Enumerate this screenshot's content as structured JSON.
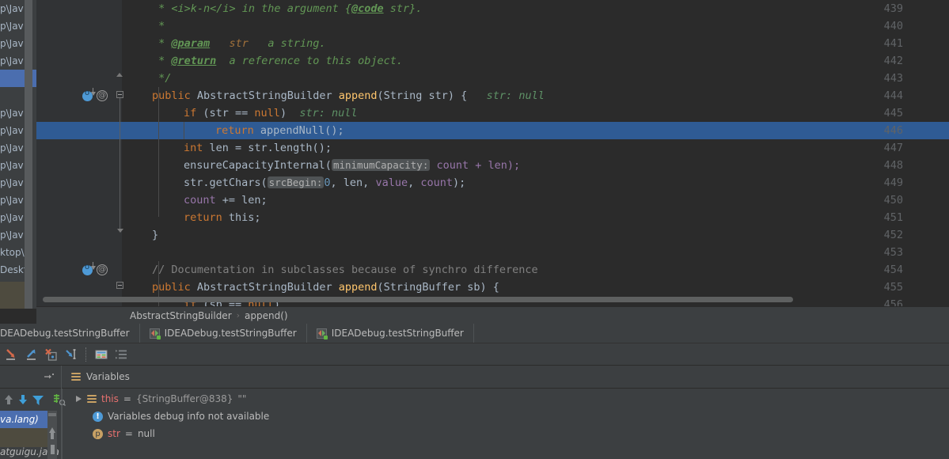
{
  "editor": {
    "first_line": 439,
    "highlighted_line": 446,
    "lines": [
      {
        "n": 439,
        "text": " * <i>k-n</i> in the argument {@code str}."
      },
      {
        "n": 440,
        "text": " *"
      },
      {
        "n": 441,
        "text": " * @param   str   a string."
      },
      {
        "n": 442,
        "text": " * @return  a reference to this object."
      },
      {
        "n": 443,
        "text": " */"
      },
      {
        "n": 444,
        "text": "public AbstractStringBuilder append(String str) {   str: null"
      },
      {
        "n": 445,
        "text": "    if (str == null)   str: null"
      },
      {
        "n": 446,
        "text": "        return appendNull();"
      },
      {
        "n": 447,
        "text": "    int len = str.length();"
      },
      {
        "n": 448,
        "text": "    ensureCapacityInternal( minimumCapacity: count + len);"
      },
      {
        "n": 449,
        "text": "    str.getChars( srcBegin: 0, len, value, count);"
      },
      {
        "n": 450,
        "text": "    count += len;"
      },
      {
        "n": 451,
        "text": "    return this;"
      },
      {
        "n": 452,
        "text": "}"
      },
      {
        "n": 453,
        "text": ""
      },
      {
        "n": 454,
        "text": "    // Documentation in subclasses because of synchro difference"
      },
      {
        "n": 455,
        "text": "public AbstractStringBuilder append(StringBuffer sb) {"
      },
      {
        "n": 456,
        "text": "    if (sb == null)"
      }
    ],
    "tokens": {
      "jd_439_a": " * ",
      "jd_439_b": "<i>k-n</i> in the argument {",
      "jd_439_tag": "@code",
      "jd_439_c": " str}.",
      "jd_440": " *",
      "jd_441_a": " * ",
      "jd_441_tag": "@param",
      "jd_441_param": "   str",
      "jd_441_desc": "   a string.",
      "jd_442_a": " * ",
      "jd_442_tag": "@return",
      "jd_442_desc": "  a reference to this object.",
      "jd_443": " */",
      "l444_kw": "public",
      "l444_type": " AbstractStringBuilder ",
      "l444_mth": "append",
      "l444_sig": "(String str) { ",
      "l444_hint": "  str: null",
      "l445_kw": "if",
      "l445_a": " (str == ",
      "l445_null": "null",
      "l445_b": ")",
      "l445_hint": "  str: null",
      "l446_kw": "return",
      "l446_call": " appendNull();",
      "l447_kw": "int",
      "l447_a": " len = str.length();",
      "l448_a": "ensureCapacityInternal(",
      "l448_hint": "minimumCapacity:",
      "l448_b": " count + len);",
      "l449_a": "str.getChars(",
      "l449_hint": "srcBegin:",
      "l449_num": "0",
      "l449_b": ", len, ",
      "l449_f1": "value",
      "l449_c": ", ",
      "l449_f2": "count",
      "l449_d": ");",
      "l450_f": "count",
      "l450_a": " += len;",
      "l451_kw": "return",
      "l451_b": " this;",
      "l452": "}",
      "l454_cmt": "// Documentation in subclasses because of synchro difference",
      "l455_kw": "public",
      "l455_type": " AbstractStringBuilder ",
      "l455_mth": "append",
      "l455_sig": "(StringBuffer sb) {",
      "l456_kw": "if",
      "l456_a": " (sb == ",
      "l456_null": "null",
      "l456_b": ")"
    },
    "gutter_icons": {
      "override_line": 444,
      "annotation_marker": "@"
    }
  },
  "breadcrumb": {
    "class_name": "AbstractStringBuilder",
    "separator": "›",
    "method_name": "append()"
  },
  "debug_tabs": [
    {
      "label": "DEADebug.testStringBuffer",
      "icon": "",
      "active": true
    },
    {
      "label": "IDEADebug.testStringBuffer",
      "icon": "run-config-icon",
      "active": false
    },
    {
      "label": "IDEADebug.testStringBuffer",
      "icon": "run-config-icon",
      "active": false
    }
  ],
  "debug_toolbar": [
    {
      "name": "step-over-button",
      "title": "Step Over"
    },
    {
      "name": "step-out-button",
      "title": "Step Out"
    },
    {
      "name": "force-step-into-button",
      "title": "Force Step Into"
    },
    {
      "name": "run-to-cursor-button",
      "title": "Run to Cursor"
    },
    {
      "name": "evaluate-expression-button",
      "title": "Evaluate Expression"
    },
    {
      "name": "show-execution-point-button",
      "title": "Show Execution Point"
    }
  ],
  "variables_panel": {
    "tab_label": "Variables",
    "side_buttons": [
      {
        "name": "move-up-button",
        "title": "Move Up"
      },
      {
        "name": "move-down-button",
        "title": "Move Down"
      },
      {
        "name": "filter-button",
        "title": "Filter"
      },
      {
        "name": "add-watch-button",
        "title": "Add Watch"
      }
    ],
    "rows": [
      {
        "icon": "variables-icon",
        "expandable": true,
        "name": "this",
        "equals": "=",
        "value": "{StringBuffer@838}",
        "extra": "\"\""
      },
      {
        "icon": "info-icon",
        "expandable": false,
        "message": "Variables debug info not available"
      },
      {
        "icon": "param-icon",
        "icon_glyph": "p",
        "expandable": false,
        "name": "str",
        "equals": "=",
        "value": "null"
      }
    ]
  },
  "background_window": {
    "rows": [
      "p\\Jav",
      "p\\Jav",
      "p\\Jav",
      "p\\Jav",
      "",
      "",
      "p\\Jav",
      "p\\Jav",
      "p\\Jav",
      "p\\Jav",
      "p\\Jav",
      "p\\Jav",
      "p\\Jav",
      "p\\Jav",
      "ktop\\",
      "Deskt"
    ],
    "selected_index": 4,
    "bottom_selected_label": "va.lang)",
    "bottom_label": "atguigu.java"
  },
  "colors": {
    "editor_bg": "#2b2b2b",
    "gutter_bg": "#313335",
    "panel_bg": "#3c3f41",
    "highlight_line": "#2f5b94",
    "selection_blue": "#4b6eaf",
    "keyword": "#cc7832",
    "javadoc": "#629755",
    "method": "#ffc66d",
    "field": "#9876aa",
    "number": "#6897bb",
    "comment": "#808080",
    "default_text": "#a9b7c6",
    "inline_hint": "#5e9166",
    "var_name": "#e8716f"
  }
}
